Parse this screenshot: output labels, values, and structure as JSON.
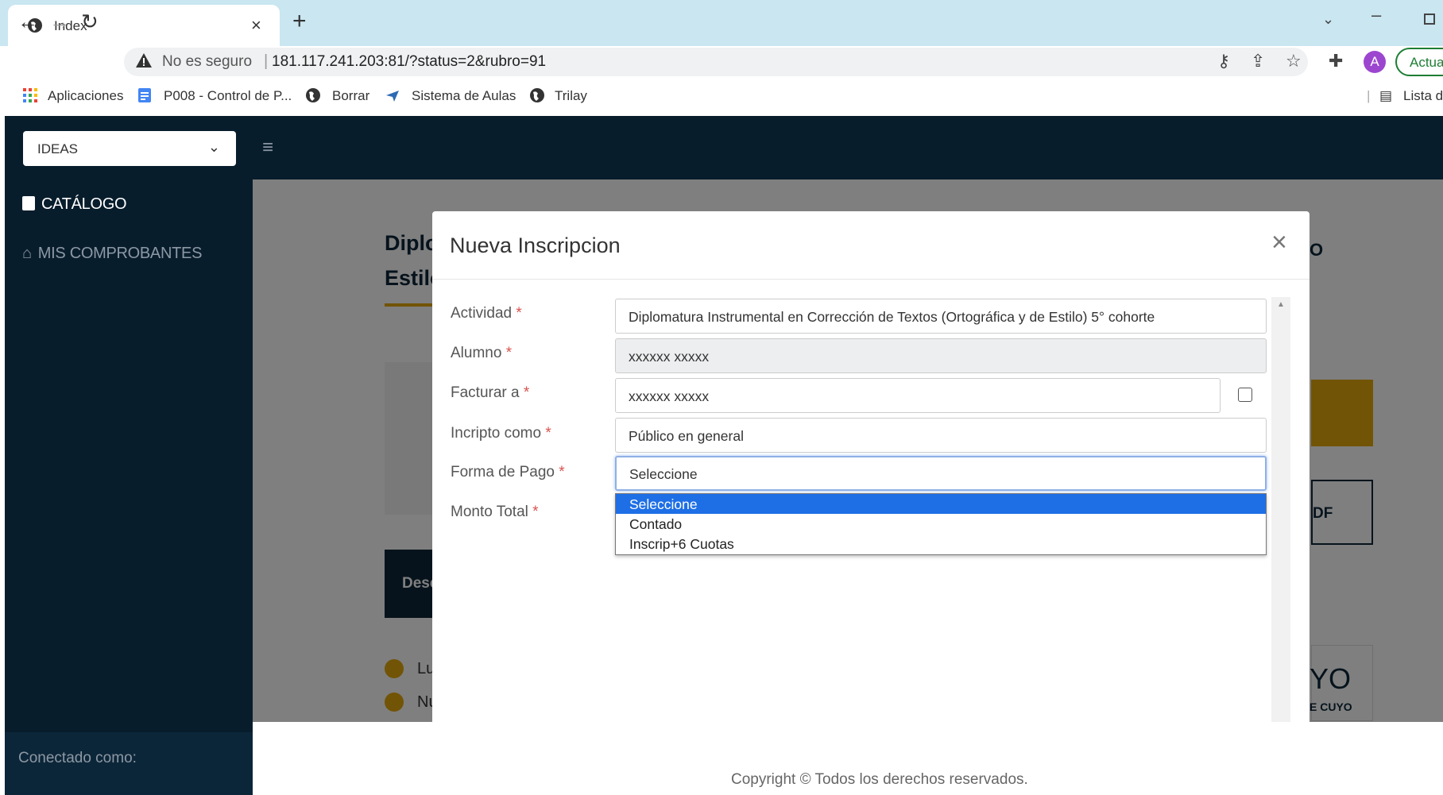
{
  "browser": {
    "tab_title": "Index",
    "tab_close": "×",
    "new_tab": "+",
    "not_secure": "No es seguro",
    "separator": "|",
    "url": "181.117.241.203:81/?status=2&rubro=91",
    "avatar_letter": "A",
    "update_label": "Actual",
    "bookmarks": [
      "Aplicaciones",
      "P008 - Control de P...",
      "Borrar",
      "Sistema de Aulas",
      "Trilay"
    ],
    "reading_list": "Lista de"
  },
  "sidebar": {
    "org_select": "IDEAS",
    "items": [
      {
        "label": "CATÁLOGO"
      },
      {
        "label": "MIS COMPROBANTES"
      }
    ],
    "footer": "Conectado como:"
  },
  "background": {
    "title_fragment": "Diplo\nEstilo",
    "dark_button": "Desc",
    "checks": [
      "Lu",
      "Nu"
    ],
    "pdf_label": "DF",
    "o_label": "O",
    "cuyo": "YO",
    "cuyo_sub": "E CUYO"
  },
  "modal": {
    "title": "Nueva Inscripcion",
    "close": "×",
    "required_mark": "*",
    "labels": {
      "actividad": "Actividad",
      "alumno": "Alumno",
      "facturar": "Facturar a",
      "inscripto": "Incripto como",
      "forma_pago": "Forma de Pago",
      "monto": "Monto Total"
    },
    "values": {
      "actividad": "Diplomatura Instrumental en Corrección de Textos (Ortográfica y de Estilo) 5° cohorte",
      "alumno": "xxxxxx xxxxx",
      "facturar": "xxxxxx xxxxx",
      "inscripto": "Público en general",
      "forma_pago": "Seleccione"
    },
    "forma_pago_options": [
      "Seleccione",
      "Contado",
      "Inscrip+6 Cuotas"
    ]
  },
  "footer": {
    "copyright": "Copyright © Todos los derechos reservados."
  },
  "colors": {
    "sidebar_bg": "#081d2c",
    "accent": "#e5a80c",
    "selection": "#1e6fe6",
    "required": "#d9534f"
  }
}
